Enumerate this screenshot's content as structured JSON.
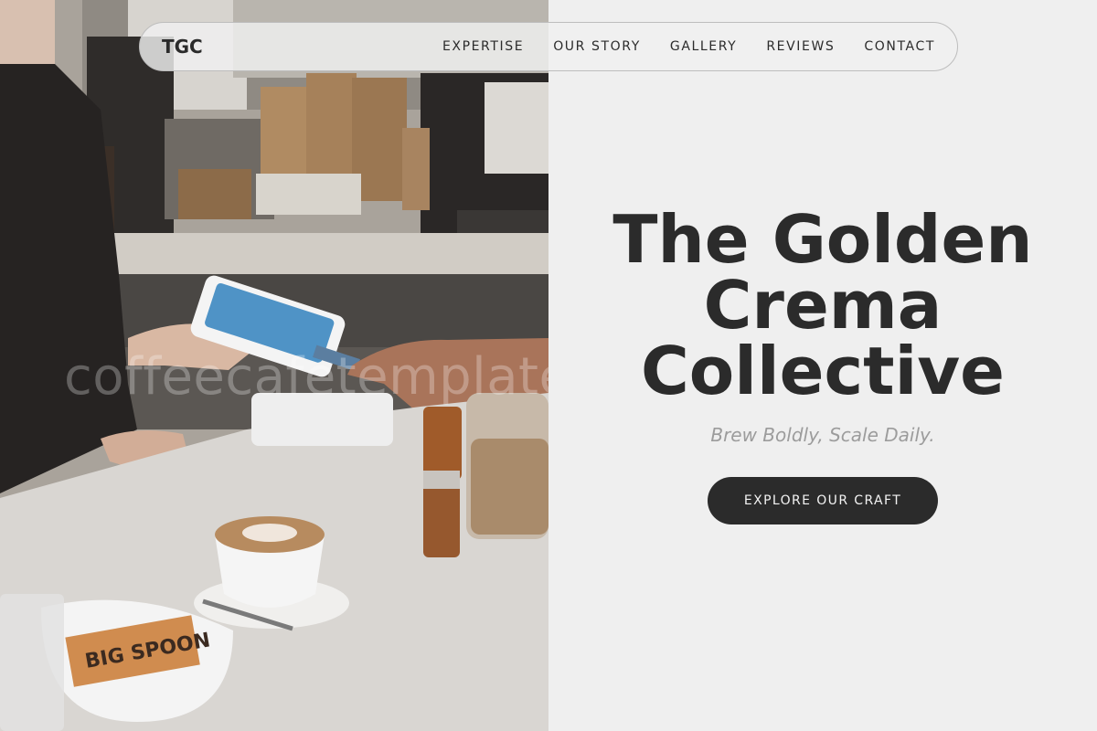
{
  "brand": {
    "logo": "TGC"
  },
  "nav": {
    "items": [
      {
        "label": "EXPERTISE"
      },
      {
        "label": "OUR STORY"
      },
      {
        "label": "GALLERY"
      },
      {
        "label": "REVIEWS"
      },
      {
        "label": "CONTACT"
      }
    ]
  },
  "hero": {
    "title": "The Golden Crema Collective",
    "tagline": "Brew Boldly, Scale Daily.",
    "cta_label": "EXPLORE OUR CRAFT",
    "watermark": "coffeecafetemplate",
    "packet_text": "BIG SPOON"
  },
  "colors": {
    "dark": "#2b2b2b",
    "page_bg": "#efefef",
    "tagline": "#9c9c9c"
  }
}
